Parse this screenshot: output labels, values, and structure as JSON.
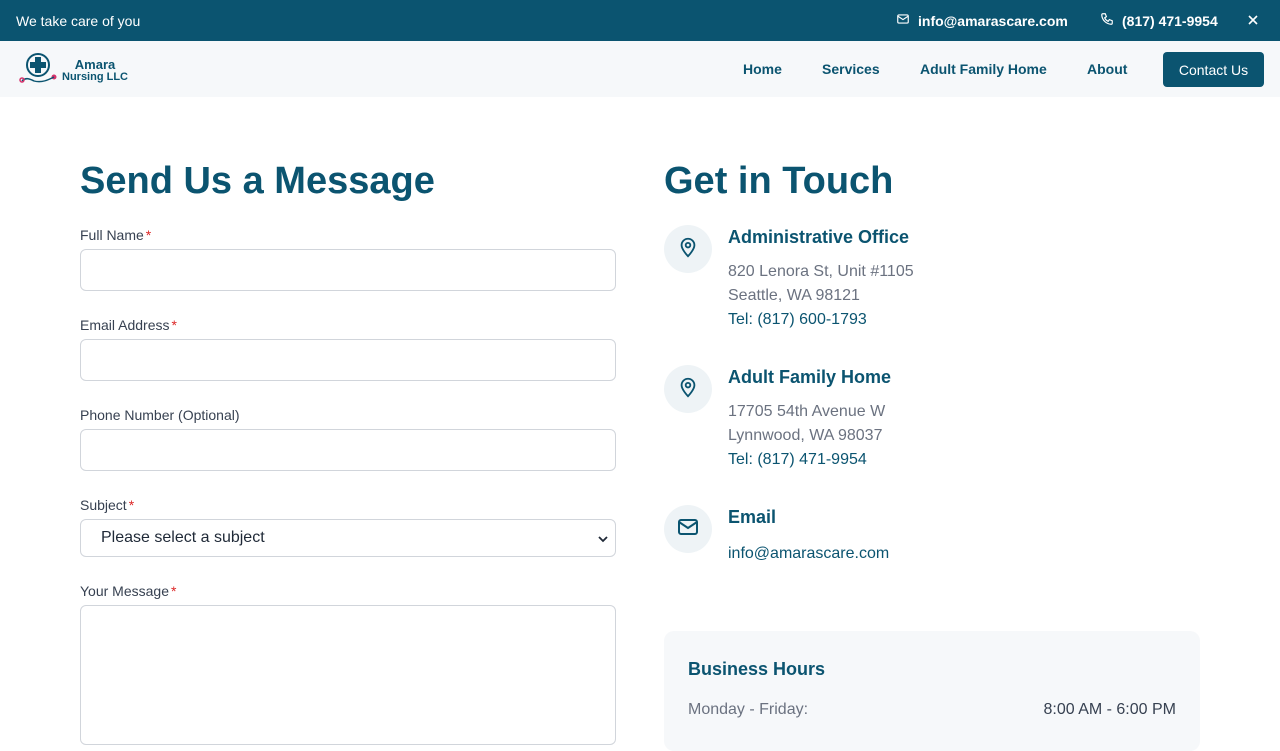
{
  "topbar": {
    "tagline": "We take care of you",
    "email": "info@amarascare.com",
    "phone": "(817) 471-9954"
  },
  "logo": {
    "line1": "Amara",
    "line2": "Nursing LLC"
  },
  "nav": {
    "items": [
      "Home",
      "Services",
      "Adult Family Home",
      "About"
    ],
    "cta": "Contact Us"
  },
  "form": {
    "title": "Send Us a Message",
    "required_mark": "*",
    "fields": {
      "name_label": "Full Name",
      "email_label": "Email Address",
      "phone_label": "Phone Number (Optional)",
      "subject_label": "Subject",
      "subject_placeholder": "Please select a subject",
      "message_label": "Your Message"
    }
  },
  "contact": {
    "title": "Get in Touch",
    "office": {
      "title": "Administrative Office",
      "line1": "820 Lenora St, Unit #1105",
      "line2": "Seattle, WA 98121",
      "tel": "Tel: (817) 600-1793"
    },
    "afh": {
      "title": "Adult Family Home",
      "line1": "17705 54th Avenue W",
      "line2": "Lynnwood, WA 98037",
      "tel": "Tel: (817) 471-9954"
    },
    "email": {
      "title": "Email",
      "address": "info@amarascare.com"
    }
  },
  "hours": {
    "title": "Business Hours",
    "day": "Monday - Friday:",
    "time": "8:00 AM - 6:00 PM"
  },
  "colors": {
    "brand": "#0b5470",
    "required": "#dc2626"
  },
  "icons": [
    "mail-icon",
    "phone-icon",
    "close-icon",
    "map-pin-icon",
    "chevron-down-icon"
  ]
}
